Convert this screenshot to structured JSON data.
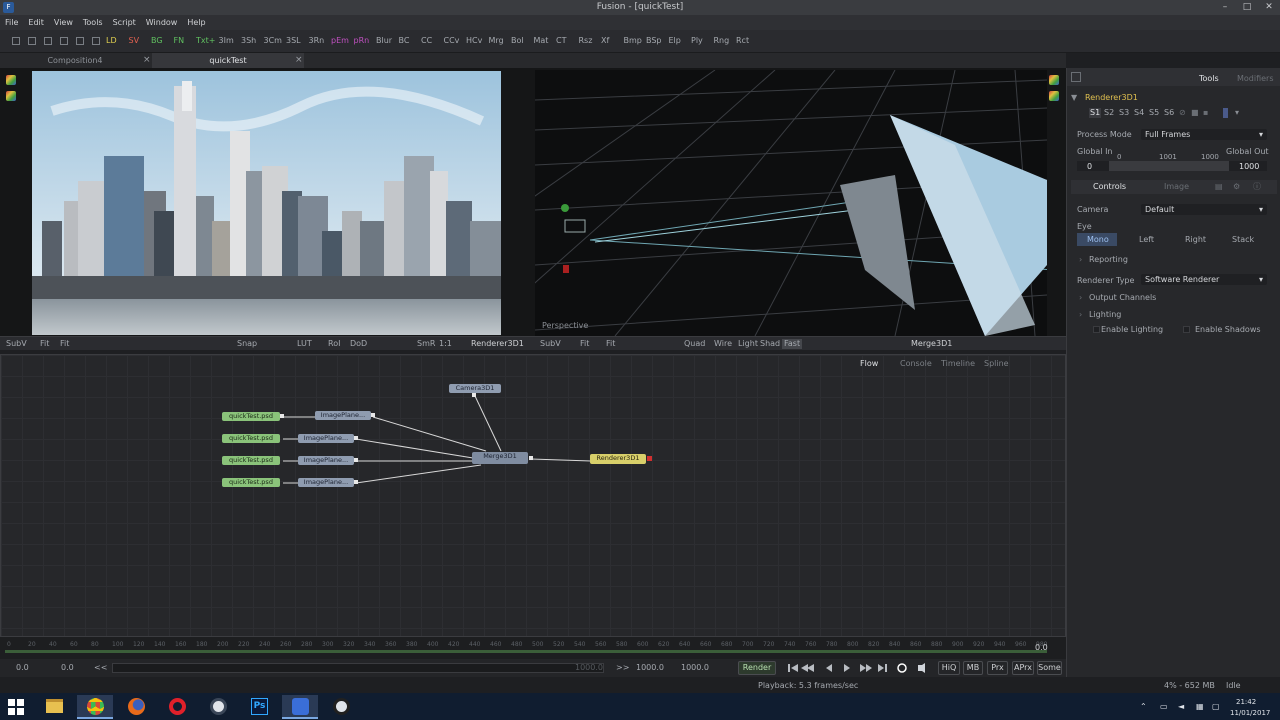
{
  "window": {
    "title": "Fusion - [quickTest]",
    "controls": [
      "minimize-icon",
      "maximize-icon",
      "close-icon"
    ]
  },
  "menu": [
    "File",
    "Edit",
    "View",
    "Tools",
    "Script",
    "Window",
    "Help"
  ],
  "toolbar": [
    {
      "t": "LD",
      "c": "#e0d050"
    },
    {
      "t": "SV",
      "c": "#e06050"
    },
    {
      "t": "BG",
      "c": "#60c060"
    },
    {
      "t": "FN",
      "c": "#60c060"
    },
    {
      "t": "Txt+",
      "c": "#60c060"
    },
    {
      "t": "3Im",
      "c": "#a6aab0"
    },
    {
      "t": "3Sh",
      "c": "#a6aab0"
    },
    {
      "t": "3Cm",
      "c": "#a6aab0"
    },
    {
      "t": "3SL",
      "c": "#a6aab0"
    },
    {
      "t": "3Rn",
      "c": "#a6aab0"
    },
    {
      "t": "pEm",
      "c": "#c050c0"
    },
    {
      "t": "pRn",
      "c": "#c050c0"
    },
    {
      "t": "Blur",
      "c": "#a6aab0"
    },
    {
      "t": "BC",
      "c": "#a6aab0"
    },
    {
      "t": "CC",
      "c": "#a6aab0"
    },
    {
      "t": "CCv",
      "c": "#a6aab0"
    },
    {
      "t": "HCv",
      "c": "#a6aab0"
    },
    {
      "t": "Mrg",
      "c": "#a6aab0"
    },
    {
      "t": "Bol",
      "c": "#a6aab0"
    },
    {
      "t": "Mat",
      "c": "#a6aab0"
    },
    {
      "t": "CT",
      "c": "#a6aab0"
    },
    {
      "t": "Rsz",
      "c": "#a6aab0"
    },
    {
      "t": "Xf",
      "c": "#a6aab0"
    },
    {
      "t": "Bmp",
      "c": "#a6aab0"
    },
    {
      "t": "BSp",
      "c": "#a6aab0"
    },
    {
      "t": "Elp",
      "c": "#a6aab0"
    },
    {
      "t": "Ply",
      "c": "#a6aab0"
    },
    {
      "t": "Rng",
      "c": "#a6aab0"
    },
    {
      "t": "Rct",
      "c": "#a6aab0"
    }
  ],
  "tabs": [
    {
      "label": "Composition4",
      "active": false
    },
    {
      "label": "quickTest",
      "active": true
    }
  ],
  "viewer_left": {
    "subv": "SubV",
    "fit": "Fit",
    "fit2": "Fit",
    "snap": "Snap",
    "lut": "LUT",
    "roi": "RoI",
    "dod": "DoD",
    "smr": "SmR",
    "ratio": "1:1",
    "node": "Renderer3D1"
  },
  "viewer_right": {
    "subv": "SubV",
    "fit": "Fit",
    "fit2": "Fit",
    "quad": "Quad",
    "wire": "Wire",
    "light": "Light",
    "shad": "Shad",
    "fast": "Fast",
    "node": "Merge3D1",
    "label": "Perspective"
  },
  "flow": {
    "tabs": [
      "Flow",
      "Console",
      "Timeline",
      "Spline"
    ],
    "nodes": {
      "camera": "Camera3D1",
      "merge": "Merge3D1",
      "renderer": "Renderer3D1",
      "loaders": [
        "quickTest.psd",
        "quickTest.psd",
        "quickTest.psd",
        "quickTest.psd"
      ],
      "planes": [
        "ImagePlane...",
        "ImagePlane...",
        "ImagePlane...",
        "ImagePlane..."
      ]
    }
  },
  "ruler": [
    "0",
    "20",
    "40",
    "60",
    "80",
    "100",
    "120",
    "140",
    "160",
    "180",
    "200",
    "220",
    "240",
    "260",
    "280",
    "300",
    "320",
    "340",
    "360",
    "380",
    "400",
    "420",
    "440",
    "460",
    "480",
    "500",
    "520",
    "540",
    "560",
    "580",
    "600",
    "620",
    "640",
    "660",
    "680",
    "700",
    "720",
    "740",
    "760",
    "780",
    "800",
    "820",
    "840",
    "860",
    "880",
    "900",
    "920",
    "940",
    "960",
    "980"
  ],
  "timeline": {
    "current": "0.0",
    "start": "0.0",
    "render_start": "0.0",
    "range_end_inner": "1000.0",
    "render_end": "1000.0",
    "end": "1000.0",
    "prev": "<<",
    "next": ">>"
  },
  "transport": {
    "render": "Render",
    "hiq": "HiQ",
    "mb": "MB",
    "prx": "Prx",
    "aprx": "APrx",
    "some": "Some"
  },
  "status": {
    "playback": "Playback: 5.3 frames/sec",
    "memory": "4% - 652 MB",
    "state": "Idle"
  },
  "inspector": {
    "tabs": [
      "Tools",
      "Modifiers"
    ],
    "node": "Renderer3D1",
    "slots": [
      "S1",
      "S2",
      "S3",
      "S4",
      "S5",
      "S6"
    ],
    "process_mode_label": "Process Mode",
    "process_mode_value": "Full Frames",
    "global_in_label": "Global In",
    "global_out_label": "Global Out",
    "global_in_value": "0",
    "global_out_value": "1000",
    "scale": [
      "0",
      "1001",
      "1000"
    ],
    "subtabs": [
      "Controls",
      "Image"
    ],
    "camera_label": "Camera",
    "camera_value": "Default",
    "eye_label": "Eye",
    "eye_options": [
      "Mono",
      "Left",
      "Right",
      "Stack"
    ],
    "reporting": "Reporting",
    "renderer_type_label": "Renderer Type",
    "renderer_type_value": "Software Renderer",
    "output_channels": "Output Channels",
    "lighting": "Lighting",
    "enable_lighting": "Enable Lighting",
    "enable_shadows": "Enable Shadows"
  },
  "taskbar": {
    "apps": [
      "windows-start-icon",
      "file-explorer-icon",
      "chrome-icon",
      "firefox-icon",
      "opera-icon",
      "steam-icon",
      "photoshop-icon",
      "fusion-icon",
      "obs-icon"
    ],
    "photoshop": "Ps",
    "time": "21:42",
    "date": "11/01/2017"
  }
}
